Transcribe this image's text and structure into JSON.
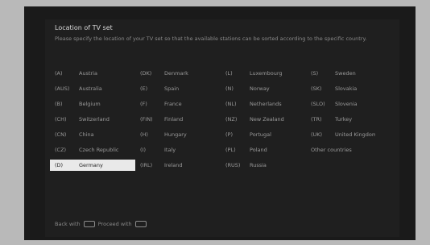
{
  "title": "Location of TV set",
  "description": "Please specify the location of your TV set so that the available stations can be sorted according to the specific country.",
  "countries": [
    {
      "code": "(A)",
      "name": "Austria",
      "col": 0,
      "row": 0
    },
    {
      "code": "(AUS)",
      "name": "Australia",
      "col": 0,
      "row": 1
    },
    {
      "code": "(B)",
      "name": "Belgium",
      "col": 0,
      "row": 2
    },
    {
      "code": "(CH)",
      "name": "Switzerland",
      "col": 0,
      "row": 3
    },
    {
      "code": "(CN)",
      "name": "China",
      "col": 0,
      "row": 4
    },
    {
      "code": "(CZ)",
      "name": "Czech Republic",
      "col": 0,
      "row": 5
    },
    {
      "code": "(D)",
      "name": "Germany",
      "col": 0,
      "row": 6,
      "selected": true
    },
    {
      "code": "(DK)",
      "name": "Denmark",
      "col": 1,
      "row": 0
    },
    {
      "code": "(E)",
      "name": "Spain",
      "col": 1,
      "row": 1
    },
    {
      "code": "(F)",
      "name": "France",
      "col": 1,
      "row": 2
    },
    {
      "code": "(FIN)",
      "name": "Finland",
      "col": 1,
      "row": 3
    },
    {
      "code": "(H)",
      "name": "Hungary",
      "col": 1,
      "row": 4
    },
    {
      "code": "(I)",
      "name": "Italy",
      "col": 1,
      "row": 5
    },
    {
      "code": "(IRL)",
      "name": "Ireland",
      "col": 1,
      "row": 6
    },
    {
      "code": "(L)",
      "name": "Luxembourg",
      "col": 2,
      "row": 0
    },
    {
      "code": "(N)",
      "name": "Norway",
      "col": 2,
      "row": 1
    },
    {
      "code": "(NL)",
      "name": "Netherlands",
      "col": 2,
      "row": 2
    },
    {
      "code": "(NZ)",
      "name": "New Zealand",
      "col": 2,
      "row": 3
    },
    {
      "code": "(P)",
      "name": "Portugal",
      "col": 2,
      "row": 4
    },
    {
      "code": "(PL)",
      "name": "Poland",
      "col": 2,
      "row": 5
    },
    {
      "code": "(RUS)",
      "name": "Russia",
      "col": 2,
      "row": 6
    },
    {
      "code": "(S)",
      "name": "Sweden",
      "col": 3,
      "row": 0
    },
    {
      "code": "(SK)",
      "name": "Slovakia",
      "col": 3,
      "row": 1
    },
    {
      "code": "(SLO)",
      "name": "Slovenia",
      "col": 3,
      "row": 2
    },
    {
      "code": "(TR)",
      "name": "Turkey",
      "col": 3,
      "row": 3
    },
    {
      "code": "(UK)",
      "name": "United Kingdom",
      "col": 3,
      "row": 4
    },
    {
      "code": "",
      "name": "Other countries",
      "col": 3,
      "row": 5
    }
  ],
  "footer": {
    "back_label": "Back with",
    "proceed_label": "Proceed with"
  }
}
